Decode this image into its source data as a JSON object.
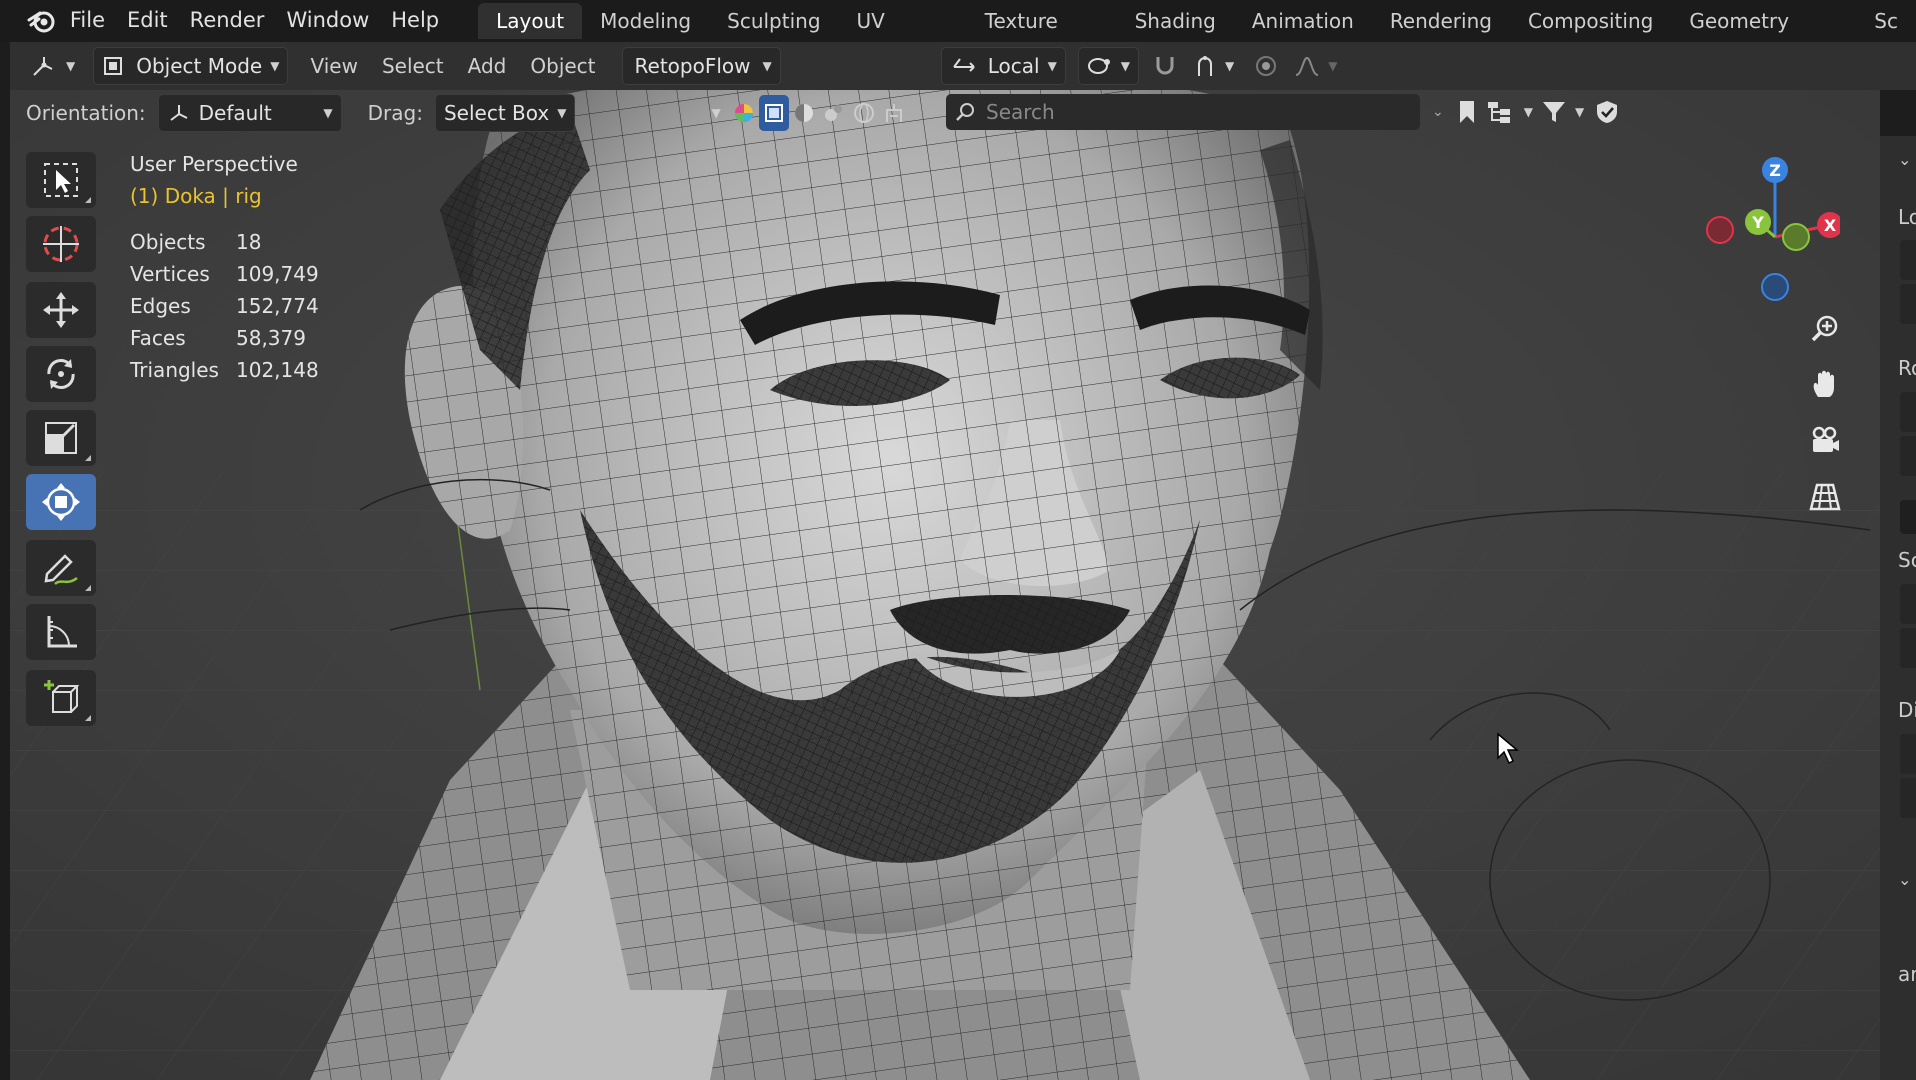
{
  "menu": [
    "File",
    "Edit",
    "Render",
    "Window",
    "Help"
  ],
  "workspaces": {
    "tabs": [
      "Layout",
      "Modeling",
      "Sculpting",
      "UV Editing",
      "Texture Paint",
      "Shading",
      "Animation",
      "Rendering",
      "Compositing",
      "Geometry Nodes",
      "Sc"
    ],
    "active": "Layout"
  },
  "header": {
    "mode": "Object Mode",
    "menus": [
      "View",
      "Select",
      "Add",
      "Object"
    ],
    "addon_menu": "RetopoFlow",
    "transform_orientation": "Local"
  },
  "tool_settings": {
    "orientation_label": "Orientation:",
    "orientation_value": "Default",
    "drag_label": "Drag:",
    "drag_value": "Select Box"
  },
  "search": {
    "placeholder": "Search"
  },
  "overlay": {
    "view_name": "User Perspective",
    "active_object": "(1) Doka | rig",
    "stats": [
      {
        "label": "Objects",
        "value": "18"
      },
      {
        "label": "Vertices",
        "value": "109,749"
      },
      {
        "label": "Edges",
        "value": "152,774"
      },
      {
        "label": "Faces",
        "value": "58,379"
      },
      {
        "label": "Triangles",
        "value": "102,148"
      }
    ]
  },
  "gizmo": {
    "x": "X",
    "y": "Y",
    "z": "Z"
  },
  "right_panel": {
    "labels": [
      "Lo",
      "Ro",
      "Sc",
      "Di",
      "ar"
    ]
  },
  "colors": {
    "accent": "#4772b3",
    "active_object": "#e8c32f",
    "axis_x": "#e0344b",
    "axis_y": "#8ac43c",
    "axis_z": "#3b83e0"
  },
  "icons": {
    "tools": [
      "select-box-icon",
      "cursor-icon",
      "move-icon",
      "rotate-icon",
      "scale-icon",
      "transform-icon",
      "annotate-icon",
      "measure-icon",
      "add-cube-icon"
    ],
    "navigation": [
      "zoom-icon",
      "pan-hand-icon",
      "camera-icon",
      "grid-perspective-icon"
    ]
  }
}
